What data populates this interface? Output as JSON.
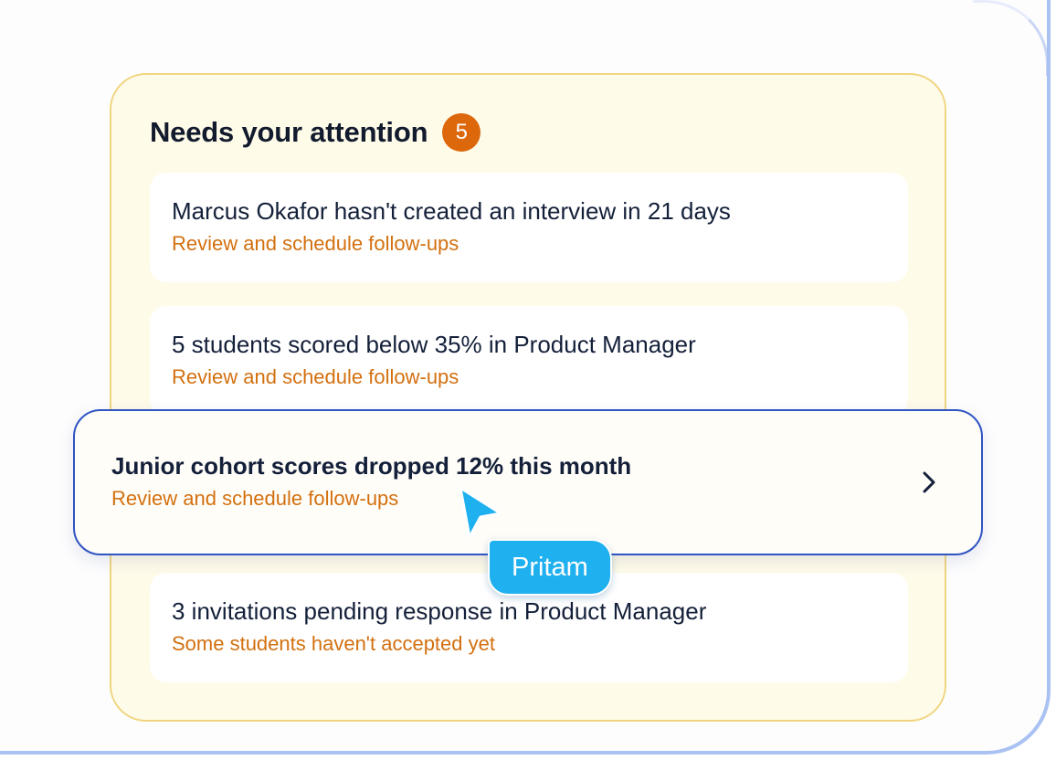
{
  "panel": {
    "title": "Needs your attention",
    "count": "5",
    "accent": "#dd680c"
  },
  "items": [
    {
      "title": "Marcus Okafor hasn't created an interview in 21 days",
      "subtitle": "Review and schedule follow-ups"
    },
    {
      "title": "5 students scored below 35% in Product Manager",
      "subtitle": "Review and schedule follow-ups"
    },
    {
      "title": "Junior cohort scores dropped 12% this month",
      "subtitle": "Review and schedule follow-ups",
      "highlighted": true
    },
    {
      "title": "3 invitations pending response in Product Manager",
      "subtitle": "Some students haven't accepted yet"
    }
  ],
  "cursor": {
    "user": "Pritam",
    "color": "#1fb0ef"
  },
  "icons": {
    "chevron": "chevron-right-icon",
    "cursor": "pointer-cursor-icon"
  }
}
